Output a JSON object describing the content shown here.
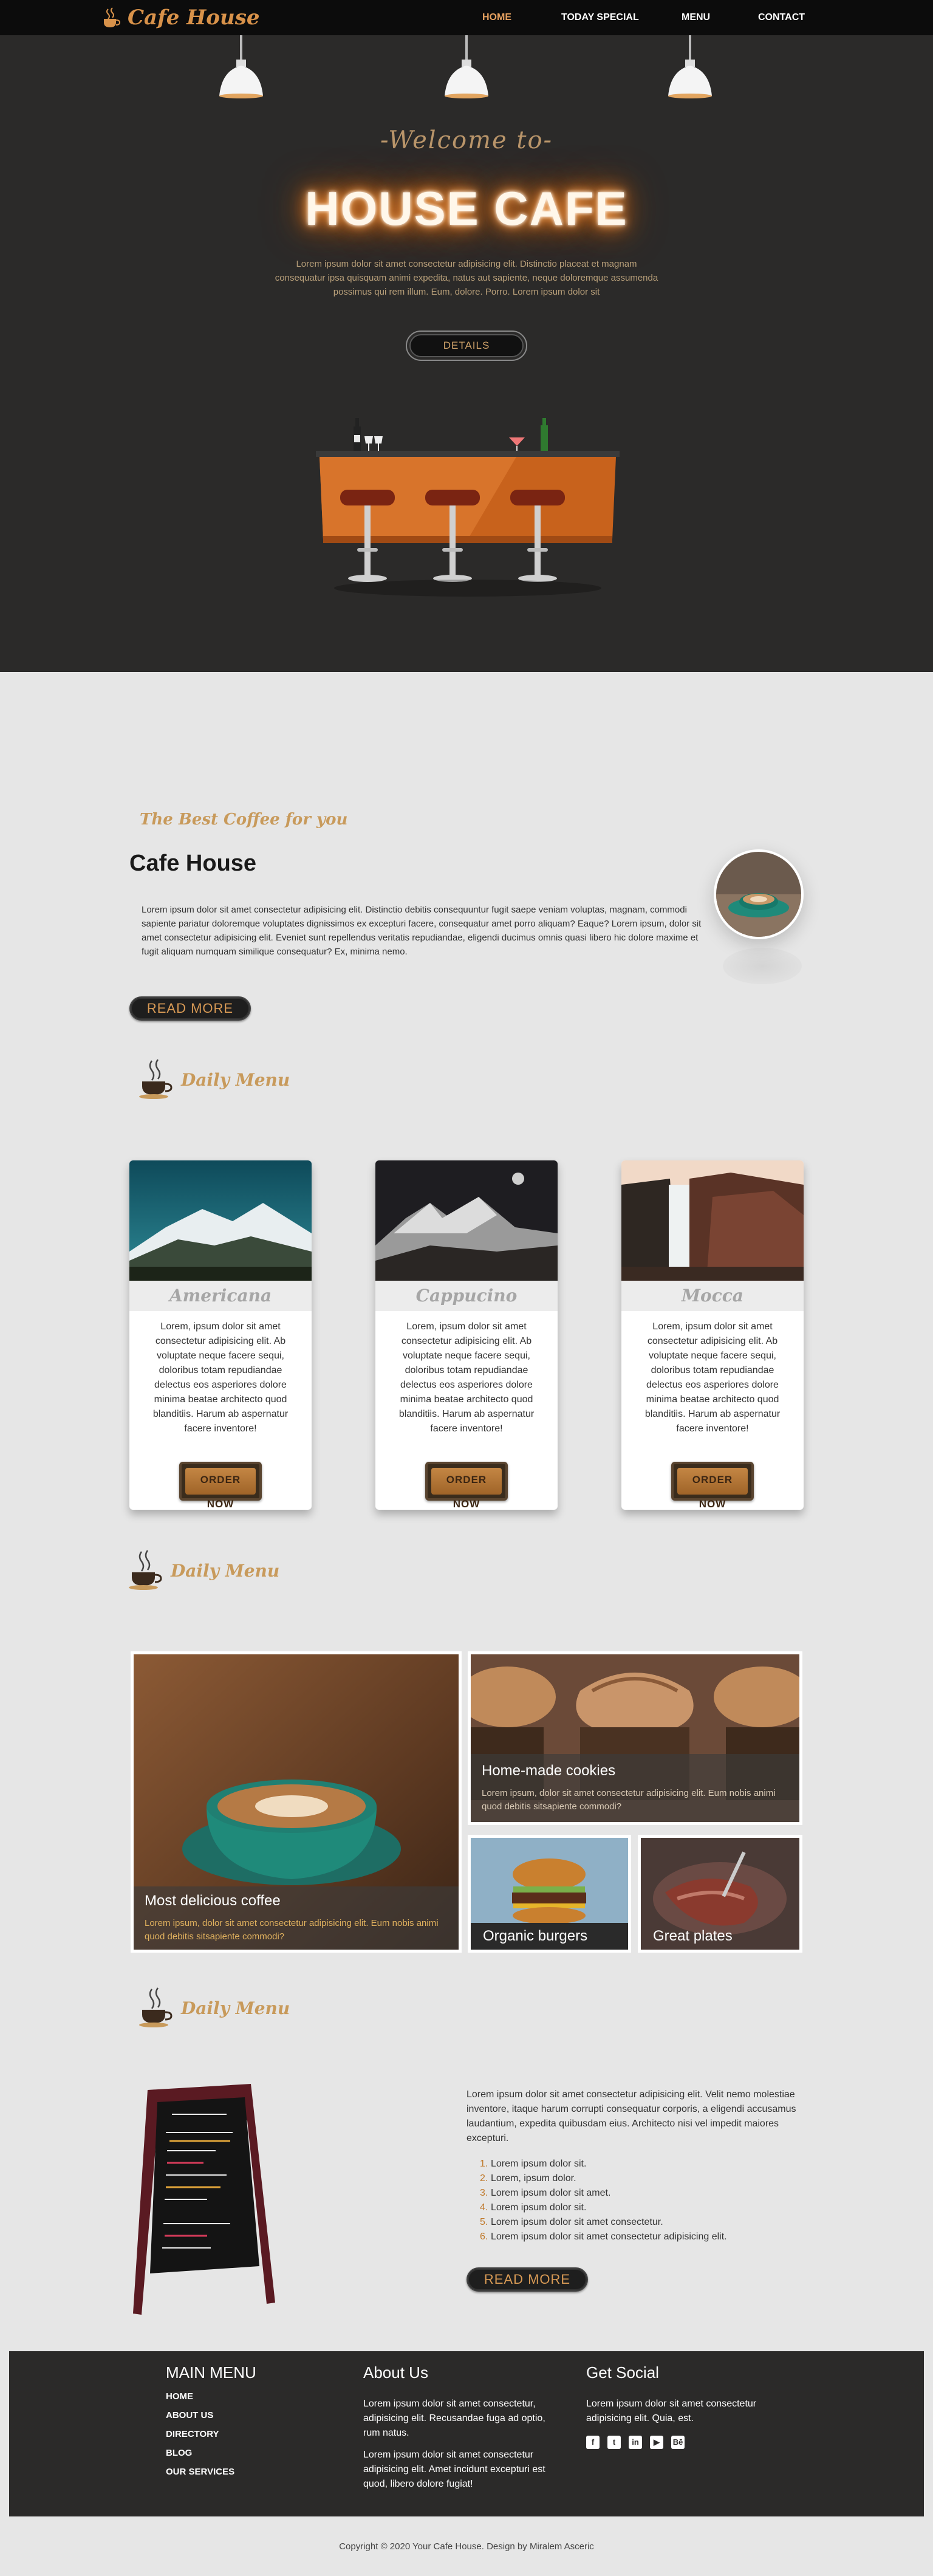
{
  "brand": {
    "name": "Cafe House",
    "accent": "#d8924a",
    "gold": "#c89a5b"
  },
  "nav": {
    "items": [
      {
        "label": "HOME",
        "active": true
      },
      {
        "label": "TODAY SPECIAL",
        "active": false
      },
      {
        "label": "MENU",
        "active": false
      },
      {
        "label": "CONTACT",
        "active": false
      }
    ]
  },
  "hero": {
    "welcome": "-Welcome to-",
    "title": "HOUSE CAFE",
    "text": "Lorem ipsum dolor sit amet consectetur adipisicing elit. Distinctio placeat et magnam consequatur ipsa quisquam animi expedita, natus aut sapiente, neque doloremque assumenda possimus qui rem illum. Eum, dolore. Porro. Lorem ipsum dolor sit",
    "button": "DETAILS"
  },
  "about": {
    "tagline": "The Best Coffee for you",
    "title": "Cafe House",
    "text": "Lorem ipsum dolor sit amet consectetur adipisicing elit. Distinctio debitis consequuntur fugit saepe veniam voluptas, magnam, commodi sapiente pariatur doloremque voluptates dignissimos ex excepturi facere, consequatur amet porro aliquam? Eaque? Lorem ipsum, dolor sit amet consectetur adipisicing elit. Eveniet sunt repellendus veritatis repudiandae, eligendi ducimus omnis quasi libero hic dolore maxime et fugit aliquam numquam similique consequatur? Ex, minima nemo.",
    "button": "READ MORE"
  },
  "daily_menu": {
    "heading": "Daily Menu",
    "order_label": "ORDER NOW",
    "items": [
      {
        "name": "Americana",
        "text": "Lorem, ipsum dolor sit amet consectetur adipisicing elit. Ab voluptate neque facere sequi, doloribus totam repudiandae delectus eos asperiores dolore minima beatae architecto quod blanditiis. Harum ab aspernatur facere inventore!"
      },
      {
        "name": "Cappucino",
        "text": "Lorem, ipsum dolor sit amet consectetur adipisicing elit. Ab voluptate neque facere sequi, doloribus totam repudiandae delectus eos asperiores dolore minima beatae architecto quod blanditiis. Harum ab aspernatur facere inventore!"
      },
      {
        "name": "Mocca",
        "text": "Lorem, ipsum dolor sit amet consectetur adipisicing elit. Ab voluptate neque facere sequi, doloribus totam repudiandae delectus eos asperiores dolore minima beatae architecto quod blanditiis. Harum ab aspernatur facere inventore!"
      }
    ]
  },
  "gallery": {
    "heading": "Daily Menu",
    "main": {
      "title": "Most delicious coffee",
      "text": "Lorem ipsum, dolor sit amet consectetur adipisicing elit. Eum nobis animi quod debitis sitsapiente commodi?"
    },
    "cookies": {
      "title": "Home-made cookies",
      "text": "Lorem ipsum, dolor sit amet consectetur adipisicing elit. Eum nobis animi quod debitis sitsapiente commodi?"
    },
    "burgers": {
      "title": "Organic burgers"
    },
    "plates": {
      "title": "Great plates"
    }
  },
  "special": {
    "heading": "Daily Menu",
    "text": "Lorem ipsum dolor sit amet consectetur adipisicing elit. Velit nemo molestiae inventore, itaque harum corrupti consequatur corporis, a eligendi accusamus laudantium, expedita quibusdam eius. Architecto nisi vel impedit maiores excepturi.",
    "list": [
      {
        "num": "1.",
        "text": "Lorem ipsum dolor sit."
      },
      {
        "num": "2.",
        "text": "Lorem, ipsum dolor."
      },
      {
        "num": "3.",
        "text": "Lorem ipsum dolor sit amet."
      },
      {
        "num": "4.",
        "text": "Lorem ipsum dolor sit."
      },
      {
        "num": "5.",
        "text": "Lorem ipsum dolor sit amet consectetur."
      },
      {
        "num": "6.",
        "text": "Lorem ipsum dolor sit amet consectetur adipisicing elit."
      }
    ],
    "button": "READ MORE"
  },
  "footer": {
    "main_menu": {
      "heading": "MAIN MENU",
      "links": [
        "HOME",
        "ABOUT US",
        "DIRECTORY",
        "BLOG",
        "OUR SERVICES"
      ]
    },
    "about": {
      "heading": "About Us",
      "text1": "Lorem ipsum dolor sit amet consectetur, adipisicing elit. Recusandae fuga ad optio, rum natus.",
      "text2": "Lorem ipsum dolor sit amet consectetur adipisicing elit. Amet incidunt excepturi est quod, libero dolore fugiat!"
    },
    "social": {
      "heading": "Get Social",
      "text": "Lorem ipsum dolor sit amet consectetur adipisicing elit. Quia, est.",
      "icons": [
        "facebook-icon",
        "twitter-icon",
        "linkedin-icon",
        "youtube-icon",
        "behance-icon"
      ],
      "icon_glyphs": [
        "f",
        "t",
        "in",
        "▶",
        "Bē"
      ]
    }
  },
  "copyright": "Copyright © 2020 Your Cafe House. Design by Miralem Asceric"
}
